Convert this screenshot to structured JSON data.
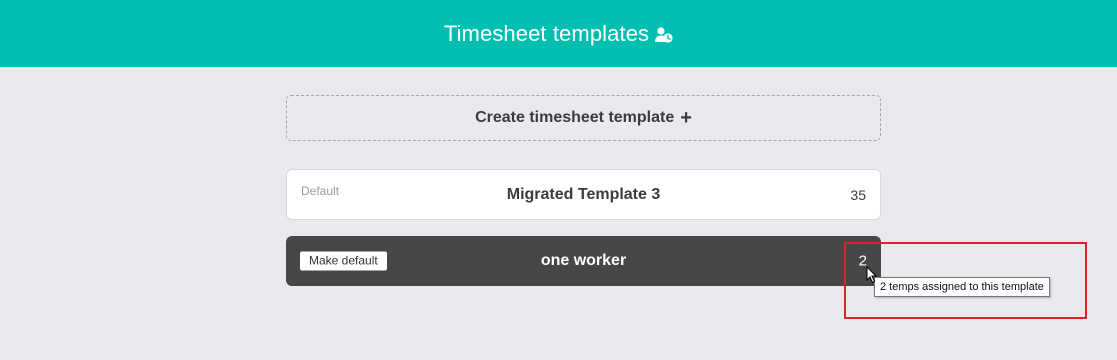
{
  "header": {
    "title": "Timesheet templates",
    "icon": "user-clock-icon",
    "background": "#00bfb0"
  },
  "create_button": {
    "label": "Create timesheet template",
    "icon": "plus-icon",
    "icon_glyph": "+"
  },
  "templates": [
    {
      "badge": "Default",
      "name": "Migrated Template 3",
      "count": "35",
      "selected": false
    },
    {
      "action_label": "Make default",
      "name": "one worker",
      "count": "2",
      "selected": true
    }
  ],
  "tooltip": {
    "text": "2 temps assigned to this template"
  },
  "colors": {
    "accent": "#00bfb0",
    "page_bg": "#e9eaee",
    "selected_card": "#474747",
    "annotation": "#d9252a"
  }
}
